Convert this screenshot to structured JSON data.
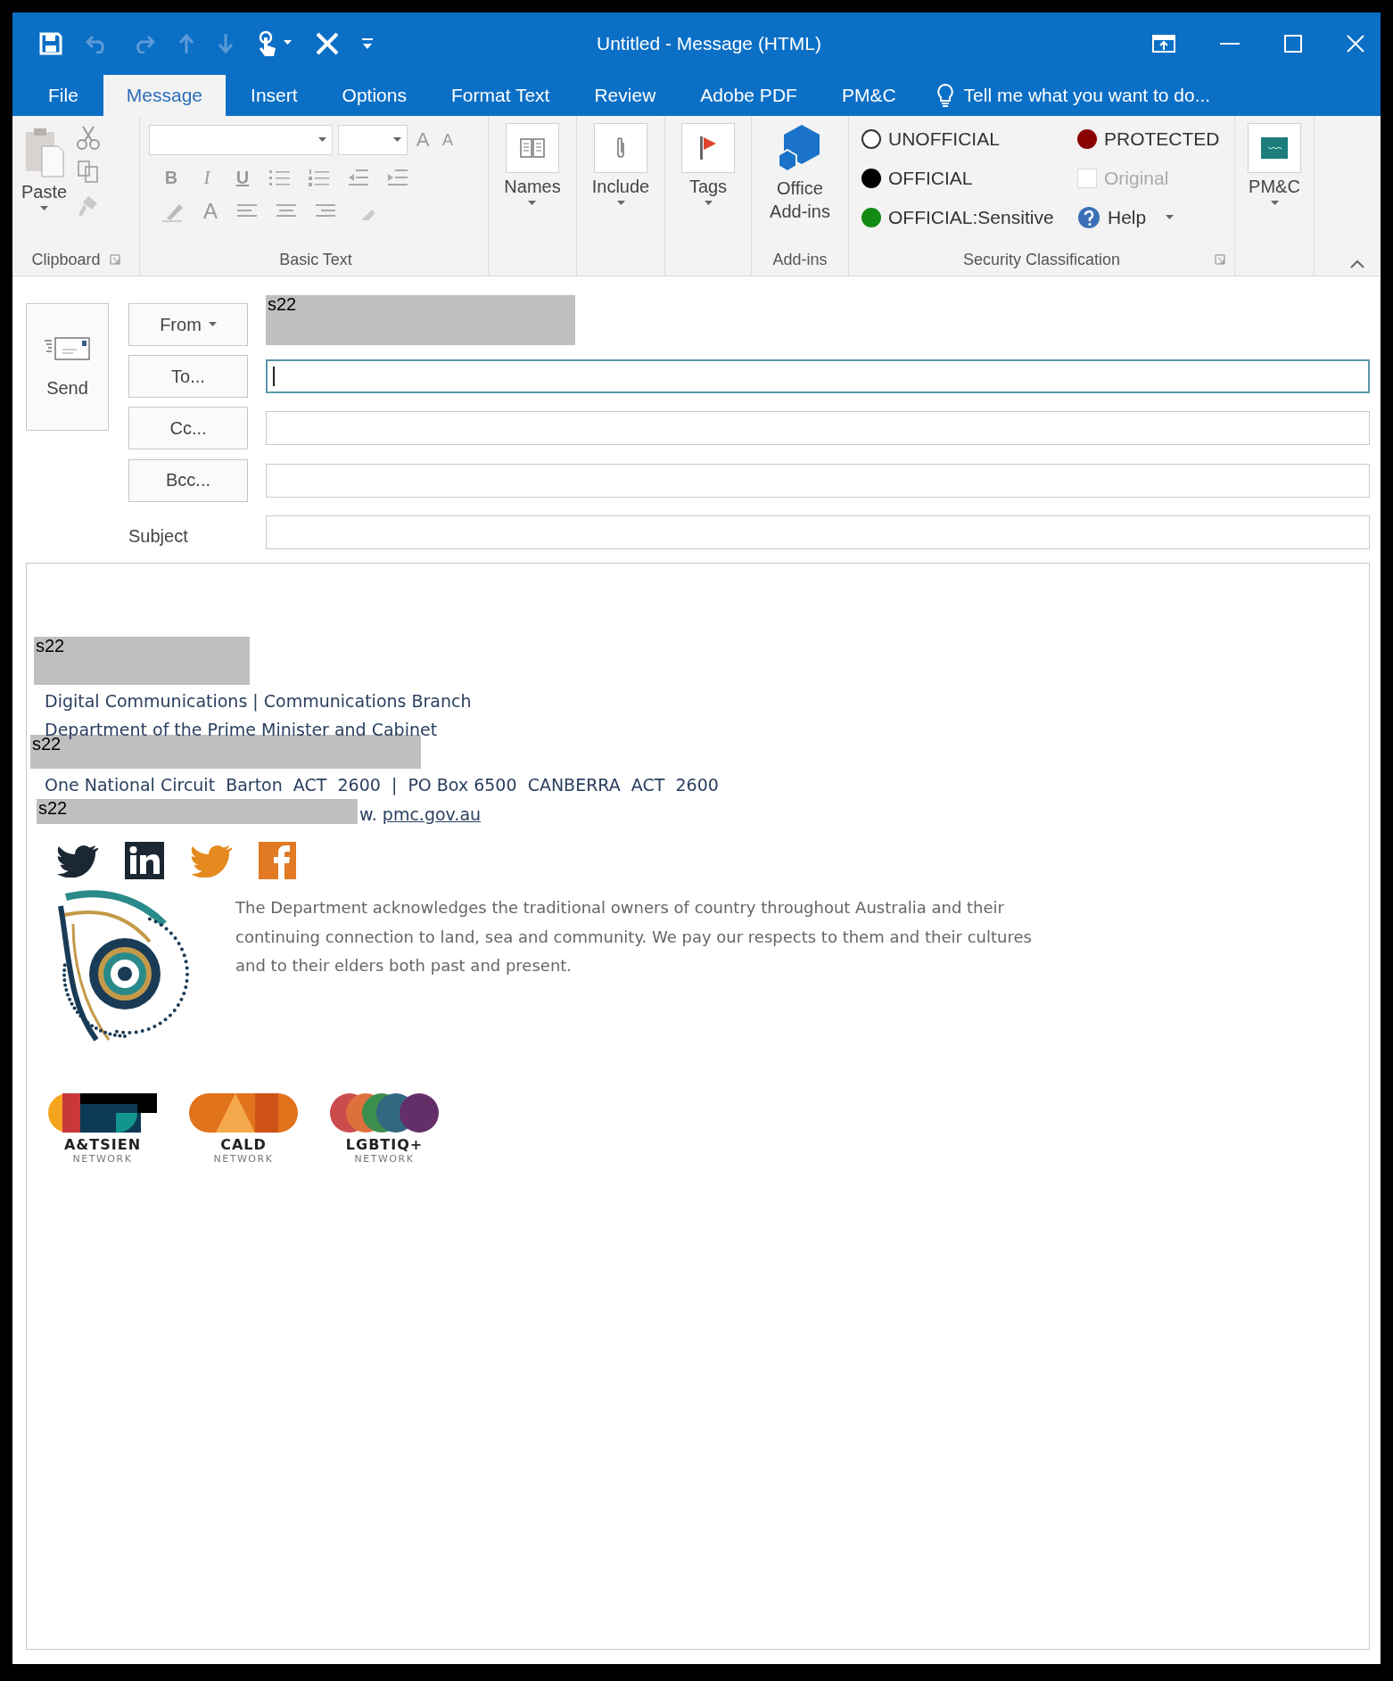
{
  "window": {
    "title": "Untitled - Message (HTML)"
  },
  "tabs": [
    {
      "label": "File",
      "selected": false
    },
    {
      "label": "Message",
      "selected": true
    },
    {
      "label": "Insert",
      "selected": false
    },
    {
      "label": "Options",
      "selected": false
    },
    {
      "label": "Format Text",
      "selected": false
    },
    {
      "label": "Review",
      "selected": false
    },
    {
      "label": "Adobe PDF",
      "selected": false
    },
    {
      "label": "PM&C",
      "selected": false
    }
  ],
  "tell_me": "Tell me what you want to do...",
  "ribbon": {
    "clipboard": {
      "paste": "Paste",
      "label": "Clipboard"
    },
    "basic_text": {
      "label": "Basic Text",
      "grow_font": "A",
      "shrink_font": "A",
      "bold": "B",
      "italic": "I",
      "underline": "U",
      "font_color": "A"
    },
    "names": "Names",
    "include": "Include",
    "tags": "Tags",
    "addins": {
      "button": "Office Add-ins",
      "label": "Add-ins"
    },
    "security": {
      "label": "Security Classification",
      "options": [
        {
          "label": "UNOFFICIAL",
          "color": "#ffffff"
        },
        {
          "label": "OFFICIAL",
          "color": "#000000"
        },
        {
          "label": "OFFICIAL:Sensitive",
          "color": "#138a13"
        },
        {
          "label": "PROTECTED",
          "color": "#8b0000"
        }
      ],
      "original": {
        "label": "Original",
        "checked": false,
        "disabled": true
      },
      "help": "Help"
    },
    "pmc": "PM&C"
  },
  "header": {
    "send": "Send",
    "from": "From",
    "from_value": "s22",
    "to": "To...",
    "cc": "Cc...",
    "bcc": "Bcc...",
    "subject": "Subject",
    "fields": [
      {
        "kind": "to",
        "focused": true
      },
      {
        "kind": "cc",
        "focused": false
      },
      {
        "kind": "bcc",
        "focused": false
      },
      {
        "kind": "subject",
        "focused": false
      }
    ]
  },
  "signature": {
    "name": "s22",
    "unit": "Digital Communications | Communications Branch",
    "department": "Department of the Prime Minister and Cabinet",
    "phone": "s22",
    "address": "One National Circuit  Barton  ACT  2600  |  PO Box 6500  CANBERRA  ACT  2600",
    "email": "s22",
    "web_prefix": "w.",
    "web": "pmc.gov.au",
    "acknowledgement": "The Department acknowledges the traditional owners of country throughout Australia and their continuing connection to land, sea and community. We pay our respects to them and their cultures and to their elders both past and present.",
    "networks": [
      {
        "kind": "atsi",
        "name": "A&TSIEN",
        "sub": "NETWORK"
      },
      {
        "kind": "cald",
        "name": "CALD",
        "sub": "NETWORK"
      },
      {
        "kind": "lgbtiq",
        "name": "LGBTIQ+",
        "sub": "NETWORK"
      }
    ]
  }
}
